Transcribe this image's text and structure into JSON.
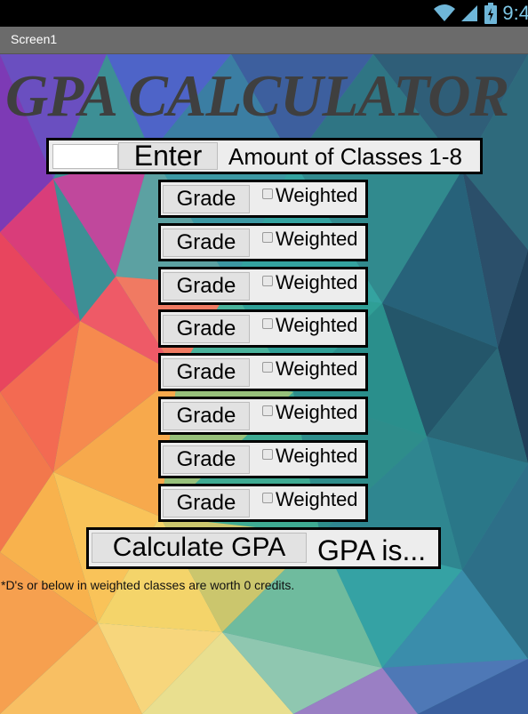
{
  "status_bar": {
    "time": "9:4",
    "icons": [
      "wifi-icon",
      "signal-icon",
      "battery-charging-icon"
    ],
    "color": "#6fb6d8"
  },
  "title_bar": {
    "title": "Screen1",
    "background": "#6b6b6b"
  },
  "app": {
    "title": "GPA CALCULATOR",
    "classes": {
      "input_value": "",
      "enter_label": "Enter",
      "label": "Amount of Classes 1-8"
    },
    "rows": [
      {
        "grade_label": "Grade",
        "weighted_label": "Weighted",
        "weighted_checked": false
      },
      {
        "grade_label": "Grade",
        "weighted_label": "Weighted",
        "weighted_checked": false
      },
      {
        "grade_label": "Grade",
        "weighted_label": "Weighted",
        "weighted_checked": false
      },
      {
        "grade_label": "Grade",
        "weighted_label": "Weighted",
        "weighted_checked": false
      },
      {
        "grade_label": "Grade",
        "weighted_label": "Weighted",
        "weighted_checked": false
      },
      {
        "grade_label": "Grade",
        "weighted_label": "Weighted",
        "weighted_checked": false
      },
      {
        "grade_label": "Grade",
        "weighted_label": "Weighted",
        "weighted_checked": false
      },
      {
        "grade_label": "Grade",
        "weighted_label": "Weighted",
        "weighted_checked": false
      }
    ],
    "calculate_label": "Calculate GPA",
    "result_text": "GPA is...",
    "footnote": "*D's or below in weighted classes are worth 0 credits."
  }
}
